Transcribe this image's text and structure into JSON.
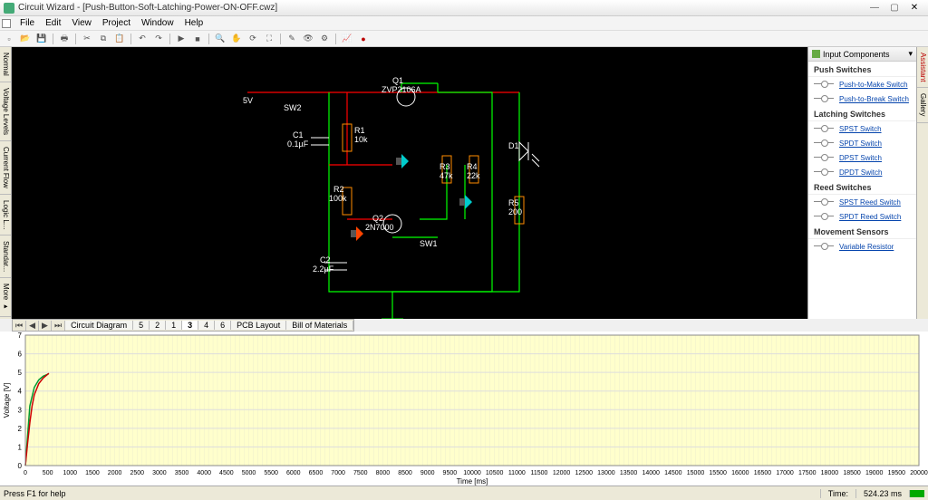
{
  "window": {
    "title": "Circuit Wizard - [Push-Button-Soft-Latching-Power-ON-OFF.cwz]"
  },
  "menu": [
    "File",
    "Edit",
    "View",
    "Project",
    "Window",
    "Help"
  ],
  "vert_tabs": [
    "Normal",
    "Voltage Levels",
    "Current Flow",
    "Logic L...",
    "Standar...",
    "More ▸"
  ],
  "right_tabs": [
    "Assistant",
    "Gallery"
  ],
  "side_panel": {
    "header": "Input Components",
    "groups": [
      {
        "title": "Push Switches",
        "items": [
          "Push-to-Make Switch",
          "Push-to-Break Switch"
        ]
      },
      {
        "title": "Latching Switches",
        "items": [
          "SPST Switch",
          "SPDT Switch",
          "DPST Switch",
          "DPDT Switch"
        ]
      },
      {
        "title": "Reed Switches",
        "items": [
          "SPST Reed Switch",
          "SPDT Reed Switch"
        ]
      },
      {
        "title": "Movement Sensors",
        "items": [
          "Variable Resistor"
        ]
      }
    ]
  },
  "tabs": {
    "items": [
      "Circuit Diagram",
      "5",
      "2",
      "1",
      "3",
      "4",
      "6",
      "PCB Layout",
      "Bill of Materials"
    ],
    "active": "3"
  },
  "circuit": {
    "supply": "5V",
    "sw2": "SW2",
    "sw1": "SW1",
    "q1_ref": "Q1",
    "q1_val": "ZVP2106A",
    "q2_ref": "Q2",
    "q2_val": "2N7000",
    "c1_ref": "C1",
    "c1_val": "0.1µF",
    "c2_ref": "C2",
    "c2_val": "2.2µF",
    "r1_ref": "R1",
    "r1_val": "10k",
    "r2_ref": "R2",
    "r2_val": "100k",
    "r3_ref": "R3",
    "r3_val": "47k",
    "r4_ref": "R4",
    "r4_val": "22k",
    "r5_ref": "R5",
    "r5_val": "200",
    "d1_ref": "D1"
  },
  "status": {
    "help": "Press F1 for help",
    "time_label": "Time:",
    "time_value": "524.23 ms"
  },
  "chart_data": {
    "type": "line",
    "title": "",
    "xlabel": "Time [ms]",
    "ylabel": "Voltage [V]",
    "xlim": [
      0,
      20000
    ],
    "ylim": [
      0,
      7
    ],
    "x_ticks": [
      0,
      500,
      1000,
      1500,
      2000,
      2500,
      3000,
      3500,
      4000,
      4500,
      5000,
      5500,
      6000,
      6500,
      7000,
      7500,
      8000,
      8500,
      9000,
      9500,
      10000,
      10500,
      11000,
      11500,
      12000,
      12500,
      13000,
      13500,
      14000,
      14500,
      15000,
      15500,
      16000,
      16500,
      17000,
      17500,
      18000,
      18500,
      19000,
      19500,
      20000
    ],
    "y_ticks": [
      0,
      1,
      2,
      3,
      4,
      5,
      6,
      7
    ],
    "series": [
      {
        "name": "trace-green",
        "color": "#009933",
        "x": [
          0,
          100,
          200,
          300,
          400,
          500,
          524
        ],
        "y": [
          0,
          3.2,
          4.2,
          4.6,
          4.8,
          4.9,
          4.95
        ]
      },
      {
        "name": "trace-red",
        "color": "#cc0000",
        "x": [
          0,
          50,
          100,
          150,
          200,
          300,
          400,
          500,
          524
        ],
        "y": [
          0,
          1.2,
          2.3,
          3.2,
          3.8,
          4.4,
          4.7,
          4.9,
          4.95
        ]
      }
    ]
  }
}
